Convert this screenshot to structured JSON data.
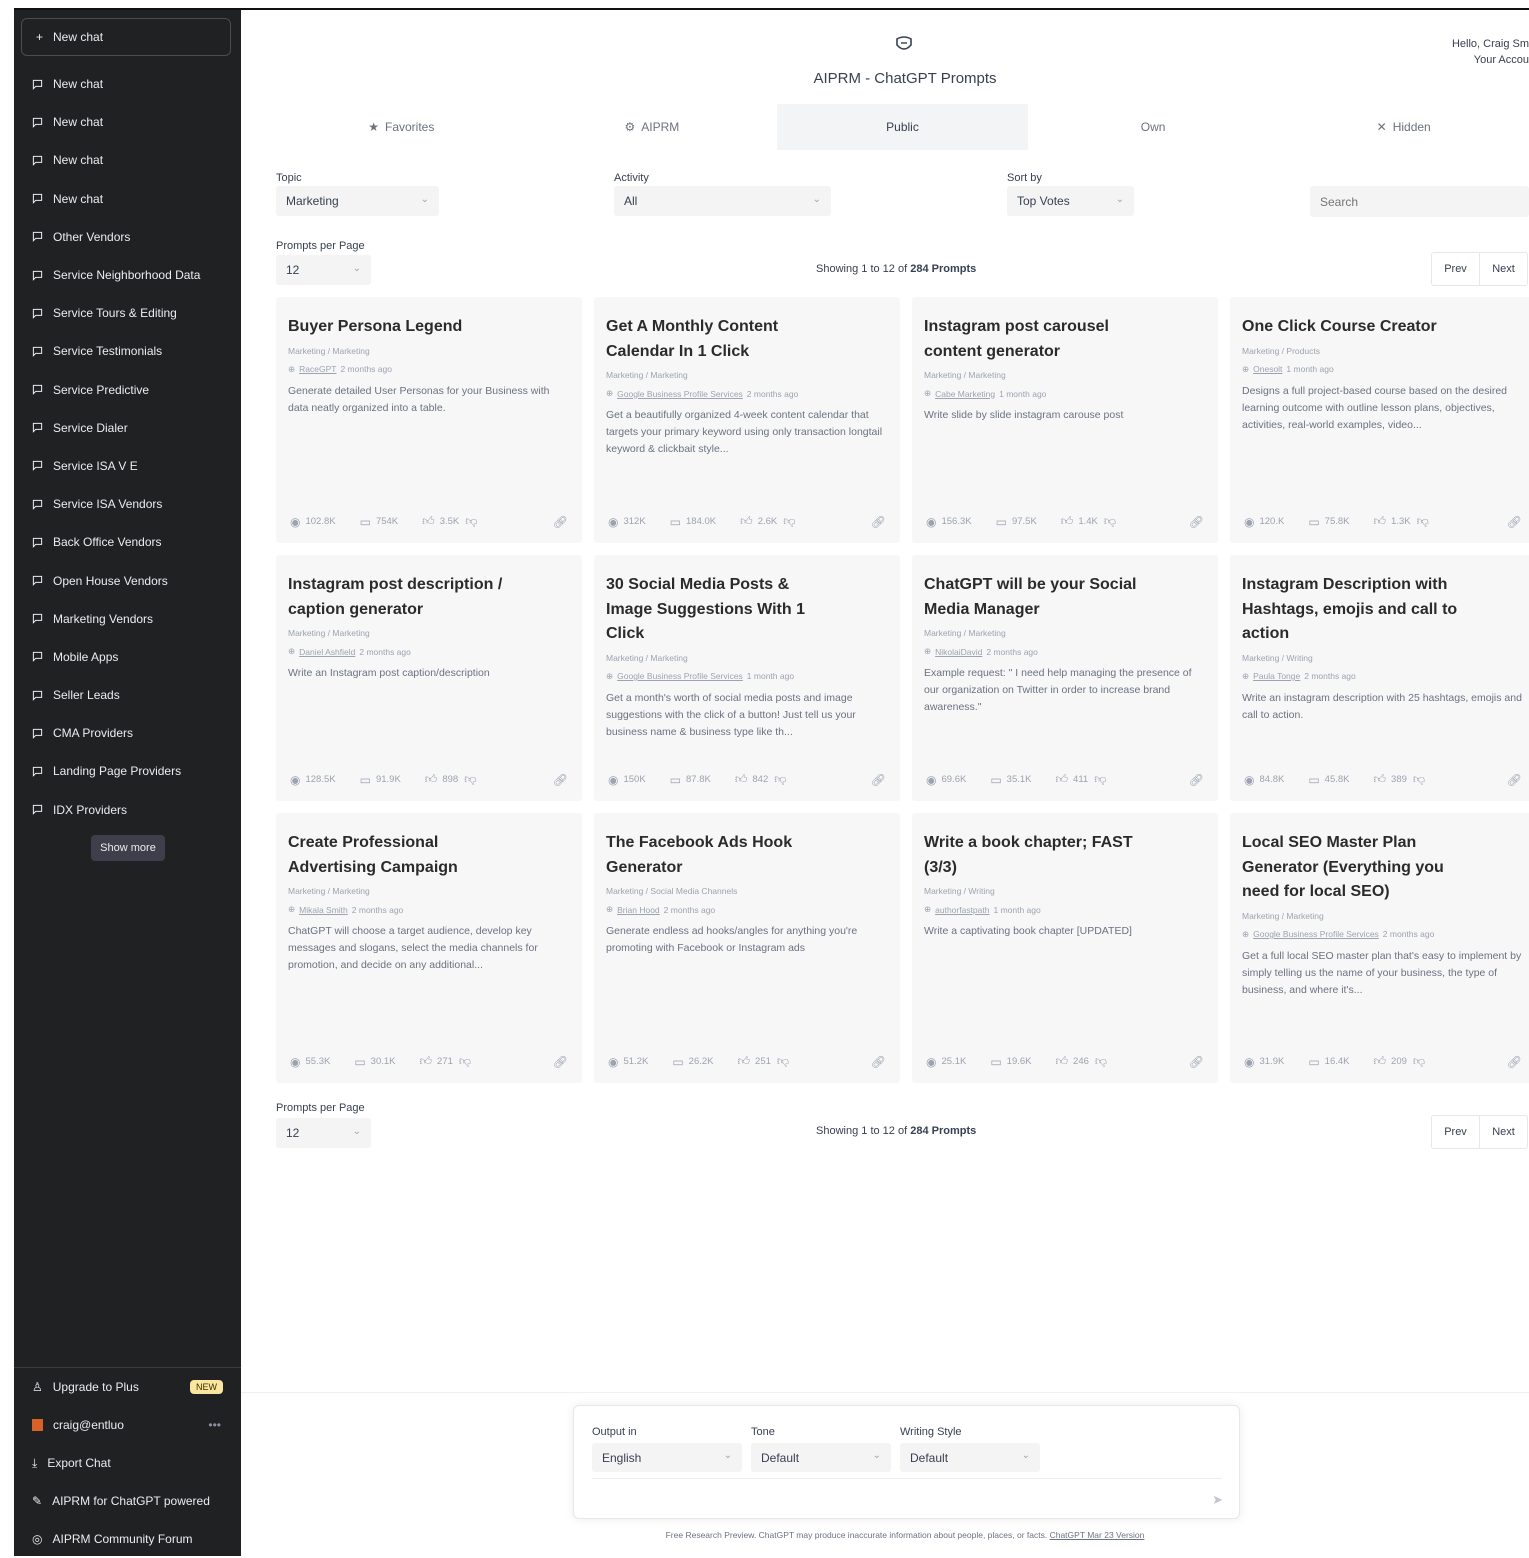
{
  "sidebar": {
    "new_chat": "New chat",
    "items": [
      "New chat",
      "New chat",
      "New chat",
      "New chat",
      "Other Vendors",
      "Service Neighborhood Data",
      "Service Tours & Editing",
      "Service Testimonials",
      "Service Predictive",
      "Service Dialer",
      "Service ISA V E",
      "Service ISA Vendors",
      "Back Office Vendors",
      "Open House Vendors",
      "Marketing Vendors",
      "Mobile Apps",
      "Seller Leads",
      "CMA Providers",
      "Landing Page Providers",
      "IDX Providers"
    ],
    "show_more": "Show more",
    "bottom": {
      "upgrade": "Upgrade to Plus",
      "new_badge": "NEW",
      "user": "craig@entluo",
      "export": "Export Chat",
      "aiprm_powered": "AIPRM for ChatGPT powered",
      "community": "AIPRM Community Forum"
    }
  },
  "header": {
    "title": "AIPRM - ChatGPT Prompts",
    "hello": "Hello, Craig Sm",
    "account": "Your Accou"
  },
  "tabs": [
    {
      "label": "Favorites",
      "icon": "★"
    },
    {
      "label": "AIPRM",
      "icon": "⚙"
    },
    {
      "label": "Public",
      "icon": ""
    },
    {
      "label": "Own",
      "icon": ""
    },
    {
      "label": "Hidden",
      "icon": "✕"
    }
  ],
  "filters": {
    "topic_label": "Topic",
    "topic_value": "Marketing",
    "activity_label": "Activity",
    "activity_value": "All",
    "sort_label": "Sort by",
    "sort_value": "Top Votes",
    "search_placeholder": "Search",
    "per_page_label": "Prompts per Page",
    "per_page_value": "12"
  },
  "pagination": {
    "showing_prefix": "Showing",
    "range": "1 to 12",
    "of": "of",
    "total": "284 Prompts",
    "prev": "Prev",
    "next": "Next"
  },
  "cards": [
    {
      "title": "Buyer Persona Legend",
      "category": "Marketing / Marketing",
      "author": "RaceGPT",
      "age": "2 months ago",
      "desc": "Generate detailed User Personas for your Business with data neatly organized into a table.",
      "views": "102.8K",
      "comments": "754K",
      "likes": "3.5K"
    },
    {
      "title": "Get A Monthly Content Calendar In 1 Click",
      "category": "Marketing / Marketing",
      "author": "Google Business Profile Services",
      "age": "2 months ago",
      "desc": "Get a beautifully organized 4-week content calendar that targets your primary keyword using only transaction longtail keyword & clickbait style...",
      "views": "312K",
      "comments": "184.0K",
      "likes": "2.6K"
    },
    {
      "title": "Instagram post carousel content generator",
      "category": "Marketing / Marketing",
      "author": "Cabe Marketing",
      "age": "1 month ago",
      "desc": "Write slide by slide instagram carouse post",
      "views": "156.3K",
      "comments": "97.5K",
      "likes": "1.4K"
    },
    {
      "title": "One Click Course Creator",
      "category": "Marketing / Products",
      "author": "Onesolt",
      "age": "1 month ago",
      "desc": "Designs a full project-based course based on the desired learning outcome with outline lesson plans, objectives, activities, real-world examples, video...",
      "views": "120.K",
      "comments": "75.8K",
      "likes": "1.3K"
    },
    {
      "title": "Instagram post description / caption generator",
      "category": "Marketing / Marketing",
      "author": "Daniel Ashfield",
      "age": "2 months ago",
      "desc": "Write an Instagram post caption/description",
      "views": "128.5K",
      "comments": "91.9K",
      "likes": "898"
    },
    {
      "title": "30 Social Media Posts & Image Suggestions With 1 Click",
      "category": "Marketing / Marketing",
      "author": "Google Business Profile Services",
      "age": "1 month ago",
      "desc": "Get a month's worth of social media posts and image suggestions with the click of a button! Just tell us your business name & business type like th...",
      "views": "150K",
      "comments": "87.8K",
      "likes": "842"
    },
    {
      "title": "ChatGPT will be your Social Media Manager",
      "category": "Marketing / Marketing",
      "author": "NikolaiDavid",
      "age": "2 months ago",
      "desc": "Example request: \" I need help managing the presence of our organization on Twitter in order to increase brand awareness.\"",
      "views": "69.6K",
      "comments": "35.1K",
      "likes": "411"
    },
    {
      "title": "Instagram Description with Hashtags, emojis and call to action",
      "category": "Marketing / Writing",
      "author": "Paula Tonge",
      "age": "2 months ago",
      "desc": "Write an instagram description with 25 hashtags, emojis and call to action.",
      "views": "84.8K",
      "comments": "45.8K",
      "likes": "389"
    },
    {
      "title": "Create Professional Advertising Campaign",
      "category": "Marketing / Marketing",
      "author": "Mikala Smith",
      "age": "2 months ago",
      "desc": "ChatGPT will choose a target audience, develop key messages and slogans, select the media channels for promotion, and decide on any additional...",
      "views": "55.3K",
      "comments": "30.1K",
      "likes": "271"
    },
    {
      "title": "The Facebook Ads Hook Generator",
      "category": "Marketing / Social Media Channels",
      "author": "Brian Hood",
      "age": "2 months ago",
      "desc": "Generate endless ad hooks/angles for anything you're promoting with Facebook or Instagram ads",
      "views": "51.2K",
      "comments": "26.2K",
      "likes": "251"
    },
    {
      "title": "Write a book chapter; FAST (3/3)",
      "category": "Marketing / Writing",
      "author": "authorfastpath",
      "age": "1 month ago",
      "desc": "Write a captivating book chapter [UPDATED]",
      "views": "25.1K",
      "comments": "19.6K",
      "likes": "246"
    },
    {
      "title": "Local SEO Master Plan Generator (Everything you need for local SEO)",
      "category": "Marketing / Marketing",
      "author": "Google Business Profile Services",
      "age": "2 months ago",
      "desc": "Get a full local SEO master plan that's easy to implement by simply telling us the name of your business, the type of business, and where it's...",
      "views": "31.9K",
      "comments": "16.4K",
      "likes": "209"
    }
  ],
  "composer": {
    "output_label": "Output in",
    "output_value": "English",
    "tone_label": "Tone",
    "tone_value": "Default",
    "style_label": "Writing Style",
    "style_value": "Default"
  },
  "footer": {
    "note": "Free Research Preview. ChatGPT may produce inaccurate information about people, places, or facts.",
    "link": "ChatGPT Mar 23 Version"
  },
  "colors": {
    "sidebar_bg": "#202123",
    "card_bg": "#f7f7f8",
    "badge": "#fae69e"
  }
}
